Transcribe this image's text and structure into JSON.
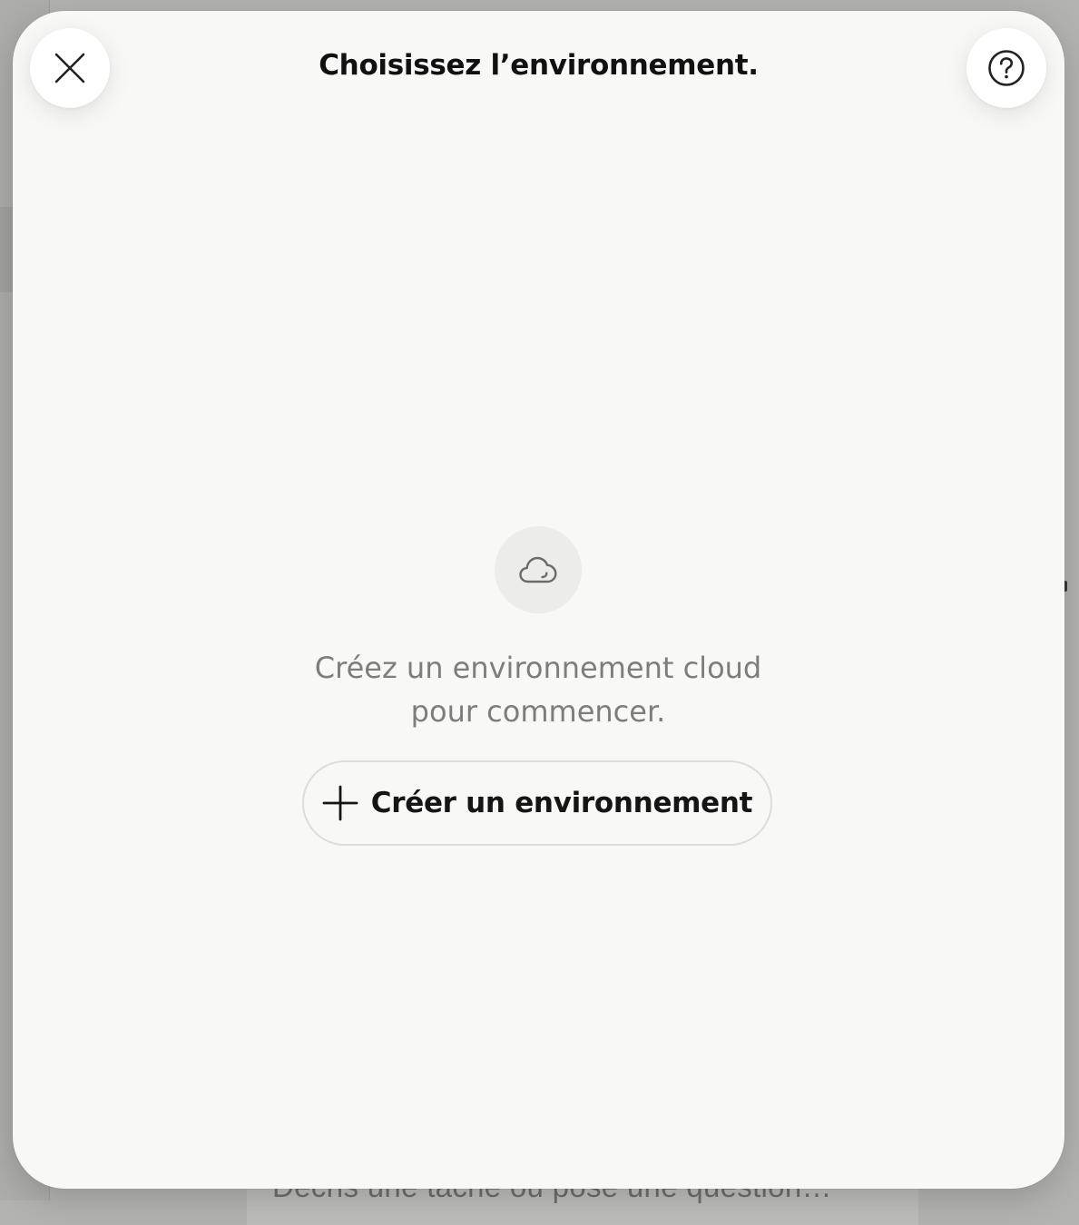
{
  "background": {
    "composer_placeholder": "Décris une tâche ou pose une question…"
  },
  "modal": {
    "title": "Choisissez l’environnement.",
    "close_icon": "close-icon",
    "help_icon": "question-circle-icon",
    "empty_state": {
      "icon": "cloud-icon",
      "message_line1": "Créez un environnement cloud",
      "message_line2": "pour commencer.",
      "create_button_icon": "plus-icon",
      "create_button_label": "Créer un environnement"
    }
  },
  "colors": {
    "overlay": "#b3b4b1",
    "modal_background": "#f8f8f6",
    "title_text": "#111111",
    "secondary_text": "#7d7d7b",
    "button_border": "#dcdcda"
  }
}
